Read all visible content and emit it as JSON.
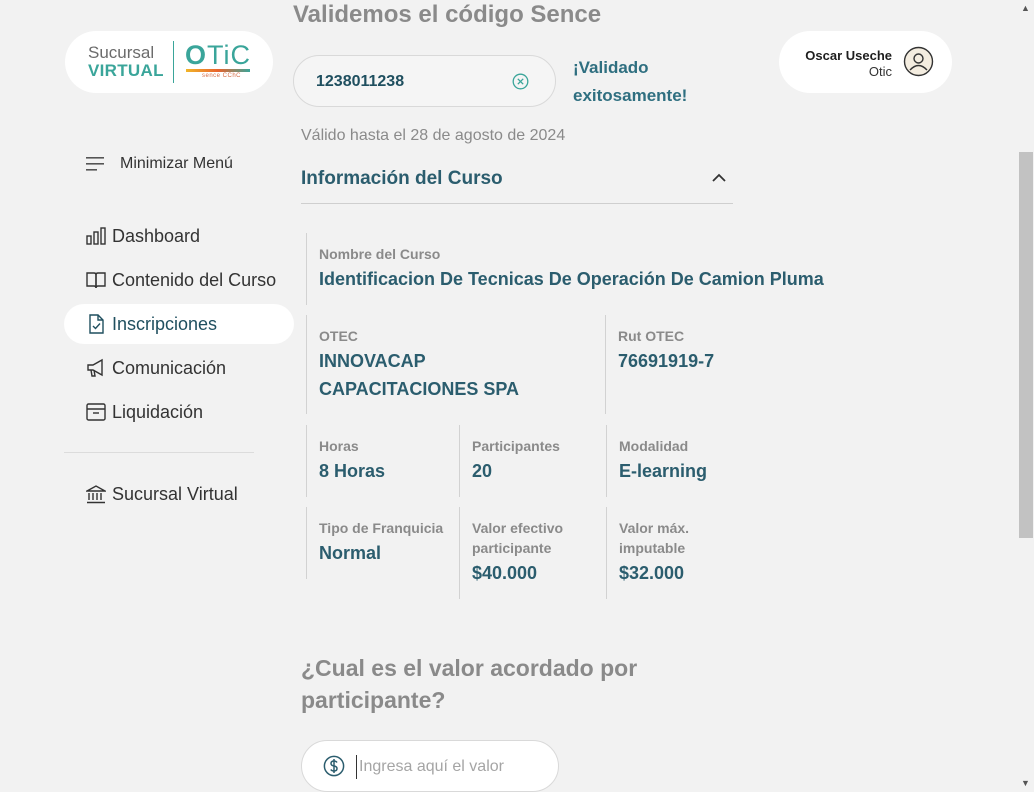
{
  "logo": {
    "line1": "Sucursal",
    "line2": "VIRTUAL",
    "brand": "OTIC",
    "brand_o": "O",
    "brand_rest": "TiC",
    "sub": "sence CChC"
  },
  "sidebar": {
    "minimize_label": "Minimizar Menú",
    "items": [
      {
        "label": "Dashboard",
        "icon": "chart-icon",
        "active": false
      },
      {
        "label": "Contenido del Curso",
        "icon": "book-icon",
        "active": false
      },
      {
        "label": "Inscripciones",
        "icon": "document-check-icon",
        "active": true
      },
      {
        "label": "Comunicación",
        "icon": "megaphone-icon",
        "active": false
      },
      {
        "label": "Liquidación",
        "icon": "archive-icon",
        "active": false
      }
    ],
    "footer_item": {
      "label": "Sucursal Virtual",
      "icon": "bank-icon"
    }
  },
  "header": {
    "title": "Validemos el código Sence",
    "code_value": "1238011238",
    "validated_text": "¡Validado exitosamente!",
    "valid_until": "Válido hasta el 28 de agosto de 2024"
  },
  "user": {
    "name": "Oscar Useche",
    "role": "Otic"
  },
  "course_info": {
    "section_title": "Información del Curso",
    "expanded": true,
    "course_name_label": "Nombre del Curso",
    "course_name": "Identificacion De Tecnicas De Operación De Camion Pluma",
    "otec_label": "OTEC",
    "otec": "INNOVACAP CAPACITACIONES SPA",
    "rut_label": "Rut OTEC",
    "rut": "76691919-7",
    "hours_label": "Horas",
    "hours": "8 Horas",
    "participants_label": "Participantes",
    "participants": "20",
    "modality_label": "Modalidad",
    "modality": "E-learning",
    "franchise_label": "Tipo de Franquicia",
    "franchise": "Normal",
    "effective_value_label": "Valor efectivo participante",
    "effective_value": "$40.000",
    "max_imputable_label": "Valor máx. imputable",
    "max_imputable": "$32.000"
  },
  "agreed_value": {
    "question": "¿Cual es el valor acordado por participante?",
    "placeholder": "Ingresa aquí el valor",
    "value": ""
  },
  "colors": {
    "accent": "#3aa59a",
    "primary_text": "#2b5d6e",
    "background": "#f2f2f2"
  }
}
